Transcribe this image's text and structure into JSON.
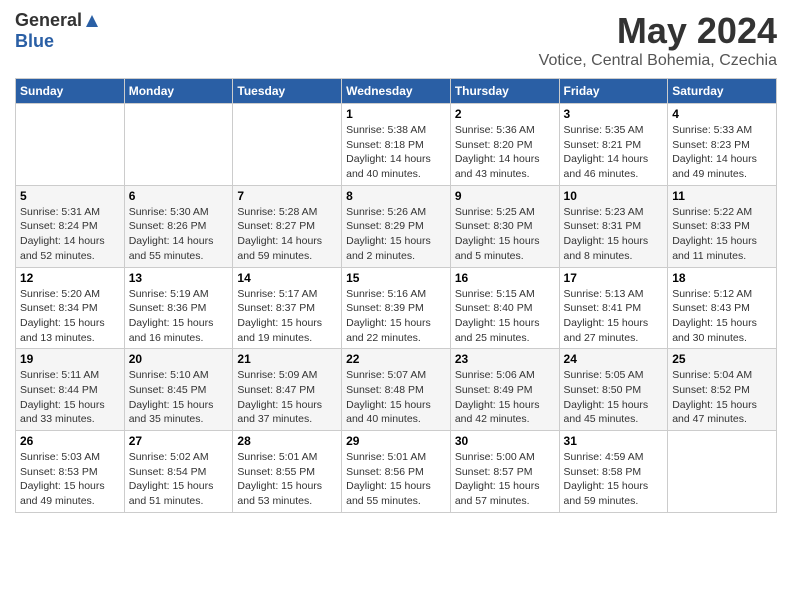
{
  "header": {
    "logo_general": "General",
    "logo_blue": "Blue",
    "month_year": "May 2024",
    "location": "Votice, Central Bohemia, Czechia"
  },
  "weekdays": [
    "Sunday",
    "Monday",
    "Tuesday",
    "Wednesday",
    "Thursday",
    "Friday",
    "Saturday"
  ],
  "weeks": [
    [
      {
        "day": "",
        "sunrise": "",
        "sunset": "",
        "daylight": ""
      },
      {
        "day": "",
        "sunrise": "",
        "sunset": "",
        "daylight": ""
      },
      {
        "day": "",
        "sunrise": "",
        "sunset": "",
        "daylight": ""
      },
      {
        "day": "1",
        "sunrise": "Sunrise: 5:38 AM",
        "sunset": "Sunset: 8:18 PM",
        "daylight": "Daylight: 14 hours and 40 minutes."
      },
      {
        "day": "2",
        "sunrise": "Sunrise: 5:36 AM",
        "sunset": "Sunset: 8:20 PM",
        "daylight": "Daylight: 14 hours and 43 minutes."
      },
      {
        "day": "3",
        "sunrise": "Sunrise: 5:35 AM",
        "sunset": "Sunset: 8:21 PM",
        "daylight": "Daylight: 14 hours and 46 minutes."
      },
      {
        "day": "4",
        "sunrise": "Sunrise: 5:33 AM",
        "sunset": "Sunset: 8:23 PM",
        "daylight": "Daylight: 14 hours and 49 minutes."
      }
    ],
    [
      {
        "day": "5",
        "sunrise": "Sunrise: 5:31 AM",
        "sunset": "Sunset: 8:24 PM",
        "daylight": "Daylight: 14 hours and 52 minutes."
      },
      {
        "day": "6",
        "sunrise": "Sunrise: 5:30 AM",
        "sunset": "Sunset: 8:26 PM",
        "daylight": "Daylight: 14 hours and 55 minutes."
      },
      {
        "day": "7",
        "sunrise": "Sunrise: 5:28 AM",
        "sunset": "Sunset: 8:27 PM",
        "daylight": "Daylight: 14 hours and 59 minutes."
      },
      {
        "day": "8",
        "sunrise": "Sunrise: 5:26 AM",
        "sunset": "Sunset: 8:29 PM",
        "daylight": "Daylight: 15 hours and 2 minutes."
      },
      {
        "day": "9",
        "sunrise": "Sunrise: 5:25 AM",
        "sunset": "Sunset: 8:30 PM",
        "daylight": "Daylight: 15 hours and 5 minutes."
      },
      {
        "day": "10",
        "sunrise": "Sunrise: 5:23 AM",
        "sunset": "Sunset: 8:31 PM",
        "daylight": "Daylight: 15 hours and 8 minutes."
      },
      {
        "day": "11",
        "sunrise": "Sunrise: 5:22 AM",
        "sunset": "Sunset: 8:33 PM",
        "daylight": "Daylight: 15 hours and 11 minutes."
      }
    ],
    [
      {
        "day": "12",
        "sunrise": "Sunrise: 5:20 AM",
        "sunset": "Sunset: 8:34 PM",
        "daylight": "Daylight: 15 hours and 13 minutes."
      },
      {
        "day": "13",
        "sunrise": "Sunrise: 5:19 AM",
        "sunset": "Sunset: 8:36 PM",
        "daylight": "Daylight: 15 hours and 16 minutes."
      },
      {
        "day": "14",
        "sunrise": "Sunrise: 5:17 AM",
        "sunset": "Sunset: 8:37 PM",
        "daylight": "Daylight: 15 hours and 19 minutes."
      },
      {
        "day": "15",
        "sunrise": "Sunrise: 5:16 AM",
        "sunset": "Sunset: 8:39 PM",
        "daylight": "Daylight: 15 hours and 22 minutes."
      },
      {
        "day": "16",
        "sunrise": "Sunrise: 5:15 AM",
        "sunset": "Sunset: 8:40 PM",
        "daylight": "Daylight: 15 hours and 25 minutes."
      },
      {
        "day": "17",
        "sunrise": "Sunrise: 5:13 AM",
        "sunset": "Sunset: 8:41 PM",
        "daylight": "Daylight: 15 hours and 27 minutes."
      },
      {
        "day": "18",
        "sunrise": "Sunrise: 5:12 AM",
        "sunset": "Sunset: 8:43 PM",
        "daylight": "Daylight: 15 hours and 30 minutes."
      }
    ],
    [
      {
        "day": "19",
        "sunrise": "Sunrise: 5:11 AM",
        "sunset": "Sunset: 8:44 PM",
        "daylight": "Daylight: 15 hours and 33 minutes."
      },
      {
        "day": "20",
        "sunrise": "Sunrise: 5:10 AM",
        "sunset": "Sunset: 8:45 PM",
        "daylight": "Daylight: 15 hours and 35 minutes."
      },
      {
        "day": "21",
        "sunrise": "Sunrise: 5:09 AM",
        "sunset": "Sunset: 8:47 PM",
        "daylight": "Daylight: 15 hours and 37 minutes."
      },
      {
        "day": "22",
        "sunrise": "Sunrise: 5:07 AM",
        "sunset": "Sunset: 8:48 PM",
        "daylight": "Daylight: 15 hours and 40 minutes."
      },
      {
        "day": "23",
        "sunrise": "Sunrise: 5:06 AM",
        "sunset": "Sunset: 8:49 PM",
        "daylight": "Daylight: 15 hours and 42 minutes."
      },
      {
        "day": "24",
        "sunrise": "Sunrise: 5:05 AM",
        "sunset": "Sunset: 8:50 PM",
        "daylight": "Daylight: 15 hours and 45 minutes."
      },
      {
        "day": "25",
        "sunrise": "Sunrise: 5:04 AM",
        "sunset": "Sunset: 8:52 PM",
        "daylight": "Daylight: 15 hours and 47 minutes."
      }
    ],
    [
      {
        "day": "26",
        "sunrise": "Sunrise: 5:03 AM",
        "sunset": "Sunset: 8:53 PM",
        "daylight": "Daylight: 15 hours and 49 minutes."
      },
      {
        "day": "27",
        "sunrise": "Sunrise: 5:02 AM",
        "sunset": "Sunset: 8:54 PM",
        "daylight": "Daylight: 15 hours and 51 minutes."
      },
      {
        "day": "28",
        "sunrise": "Sunrise: 5:01 AM",
        "sunset": "Sunset: 8:55 PM",
        "daylight": "Daylight: 15 hours and 53 minutes."
      },
      {
        "day": "29",
        "sunrise": "Sunrise: 5:01 AM",
        "sunset": "Sunset: 8:56 PM",
        "daylight": "Daylight: 15 hours and 55 minutes."
      },
      {
        "day": "30",
        "sunrise": "Sunrise: 5:00 AM",
        "sunset": "Sunset: 8:57 PM",
        "daylight": "Daylight: 15 hours and 57 minutes."
      },
      {
        "day": "31",
        "sunrise": "Sunrise: 4:59 AM",
        "sunset": "Sunset: 8:58 PM",
        "daylight": "Daylight: 15 hours and 59 minutes."
      },
      {
        "day": "",
        "sunrise": "",
        "sunset": "",
        "daylight": ""
      }
    ]
  ]
}
